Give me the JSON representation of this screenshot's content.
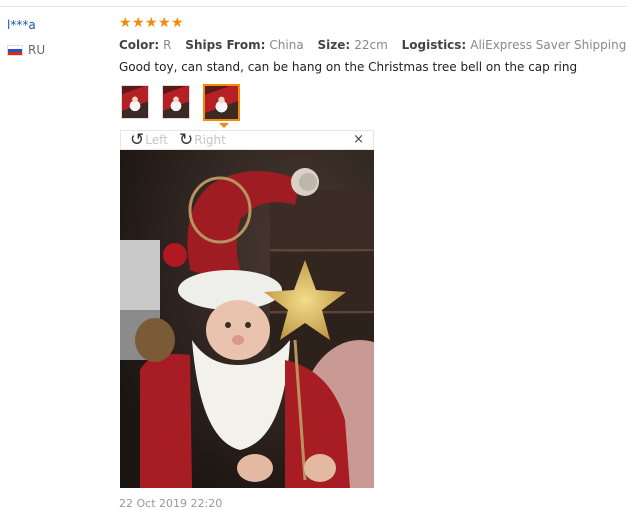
{
  "review": {
    "user": {
      "name": "l***a",
      "country": "RU",
      "flag_icon": "russia-flag-icon"
    },
    "rating": 5,
    "stars": [
      "★",
      "★",
      "★",
      "★",
      "★"
    ],
    "attributes": [
      {
        "key": "Color:",
        "value": "R"
      },
      {
        "key": "Ships From:",
        "value": "China"
      },
      {
        "key": "Size:",
        "value": "22cm"
      },
      {
        "key": "Logistics:",
        "value": "AliExpress Saver Shipping"
      }
    ],
    "text": "Good toy, can stand, can be hang on the Christmas tree bell on the cap ring",
    "thumbnails": [
      {
        "label": "photo 1",
        "active": false
      },
      {
        "label": "photo 2",
        "active": false
      },
      {
        "label": "photo 3",
        "active": true
      }
    ],
    "date": "22 Oct 2019 22:20"
  },
  "viewer": {
    "rotate_left_label": "Left",
    "rotate_right_label": "Right",
    "close_label": "×",
    "rotate_left_icon": "rotate-left-icon",
    "rotate_right_icon": "rotate-right-icon",
    "close_icon": "close-icon"
  },
  "colors": {
    "accent": "#f28a0a",
    "username": "#1a57b8",
    "muted": "#888888"
  }
}
